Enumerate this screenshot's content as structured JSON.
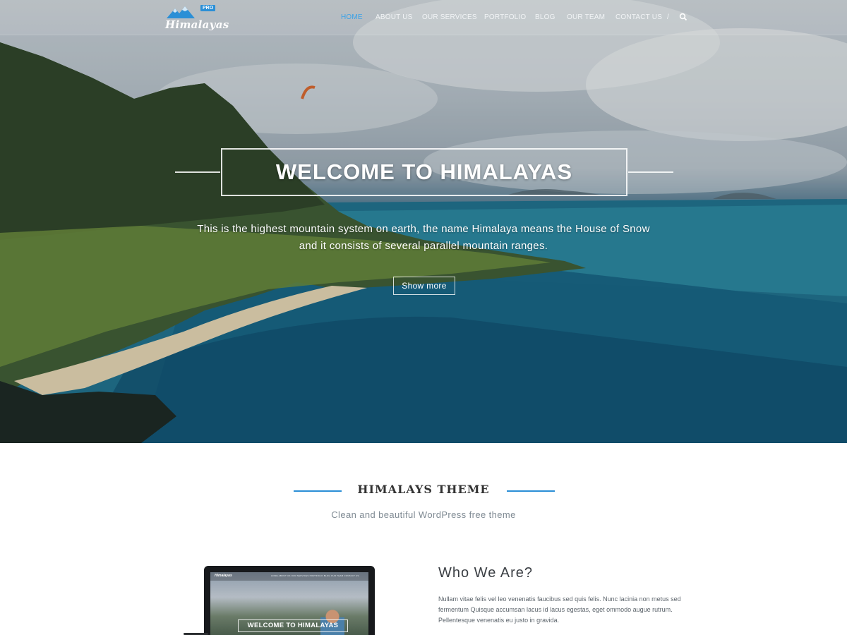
{
  "header": {
    "logo_text": "Himalayas",
    "logo_badge": "PRO",
    "nav": [
      {
        "label": "HOME",
        "active": true
      },
      {
        "label": "ABOUT US",
        "active": false
      },
      {
        "label": "OUR SERVICES",
        "active": false
      },
      {
        "label": "PORTFOLIO",
        "active": false
      },
      {
        "label": "BLOG",
        "active": false
      },
      {
        "label": "OUR TEAM",
        "active": false
      },
      {
        "label": "CONTACT US",
        "active": false
      }
    ],
    "separator": "/",
    "search_icon": "search-icon"
  },
  "hero": {
    "title": "WELCOME TO HIMALAYAS",
    "description_line1": "This is the highest mountain system on earth, the name Himalaya means the House of Snow",
    "description_line2": "and it consists of several parallel mountain ranges.",
    "button_label": "Show more"
  },
  "section": {
    "heading": "HIMALAYS THEME",
    "subheading": "Clean and beautiful WordPress free theme"
  },
  "preview": {
    "logo_text": "Himalayas",
    "nav_text": "HOME   ABOUT US   OUR SERVICES   PORTFOLIO   BLOG   OUR TEAM   CONTACT US",
    "title": "WELCOME TO HIMALAYAS"
  },
  "about": {
    "title": "Who We Are?",
    "text": "Nullam vitae felis vel leo venenatis faucibus sed quis felis. Nunc lacinia non metus sed fermentum Quisque accumsan lacus id lacus egestas, eget ommodo augue rutrum. Pellentesque venenatis eu justo in gravida."
  },
  "colors": {
    "accent": "#2b8fd6",
    "active_nav": "#3aa2e8",
    "heading_text": "#333333",
    "sub_text": "#7f8a93"
  }
}
